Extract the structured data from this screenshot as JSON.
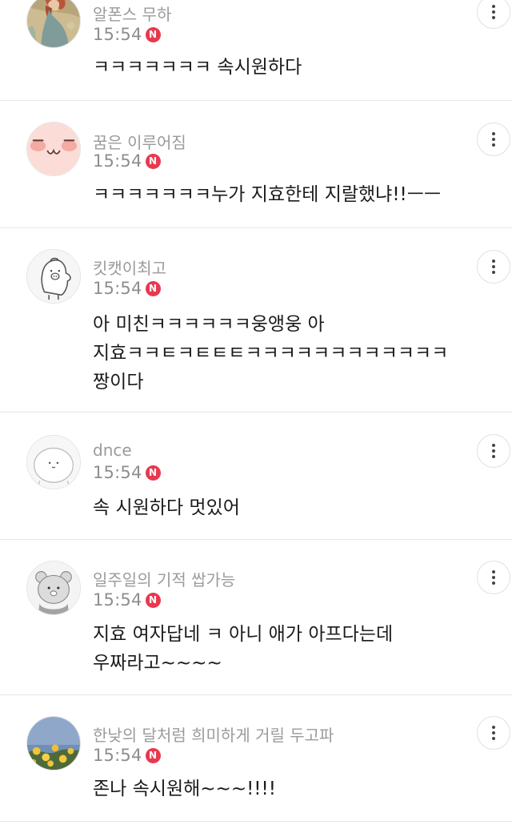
{
  "comments": [
    {
      "author": "알폰스 무하",
      "time": "15:54",
      "badge": "N",
      "lines": [
        "ㅋㅋㅋㅋㅋㅋㅋ 속시원하다"
      ],
      "avatar_icon": "art-nouveau-portrait-avatar"
    },
    {
      "author": "꿈은 이루어짐",
      "time": "15:54",
      "badge": "N",
      "lines": [
        "ㅋㅋㅋㅋㅋㅋㅋ누가 지효한테 지랄했냐!!ㅡㅡ"
      ],
      "avatar_icon": "blushing-face-avatar"
    },
    {
      "author": "킷캣이최고",
      "time": "15:54",
      "badge": "N",
      "lines": [
        "아 미친ㅋㅋㅋㅋㅋㅋ웅앵웅 아",
        "지효ㅋㅋㅌㅋㅌㅌㅌㅋㅋㅋㅋㅋㅋㅋㅋㅋㅋㅋㅋ",
        "짱이다"
      ],
      "avatar_icon": "pig-doodle-avatar"
    },
    {
      "author": "dnce",
      "time": "15:54",
      "badge": "N",
      "lines": [
        "속 시원하다 멋있어"
      ],
      "avatar_icon": "round-blob-avatar"
    },
    {
      "author": "일주일의 기적 쌉가능",
      "time": "15:54",
      "badge": "N",
      "lines": [
        "지효 여자답네 ㅋ 아니 애가 아프다는데",
        "우짜라고~~~~"
      ],
      "avatar_icon": "grey-bear-avatar"
    },
    {
      "author": "한낮의 달처럼 희미하게 거릴 두고파",
      "time": "15:54",
      "badge": "N",
      "lines": [
        "존나 속시원해~~~!!!!"
      ],
      "avatar_icon": "yellow-flowers-avatar"
    }
  ],
  "more_icon": "more-vertical-icon",
  "colors": {
    "badge": "#e8384f",
    "author": "#9b9b9b",
    "time": "#8e8e8e",
    "text": "#1b1b1b",
    "divider": "#e6e6e6"
  }
}
